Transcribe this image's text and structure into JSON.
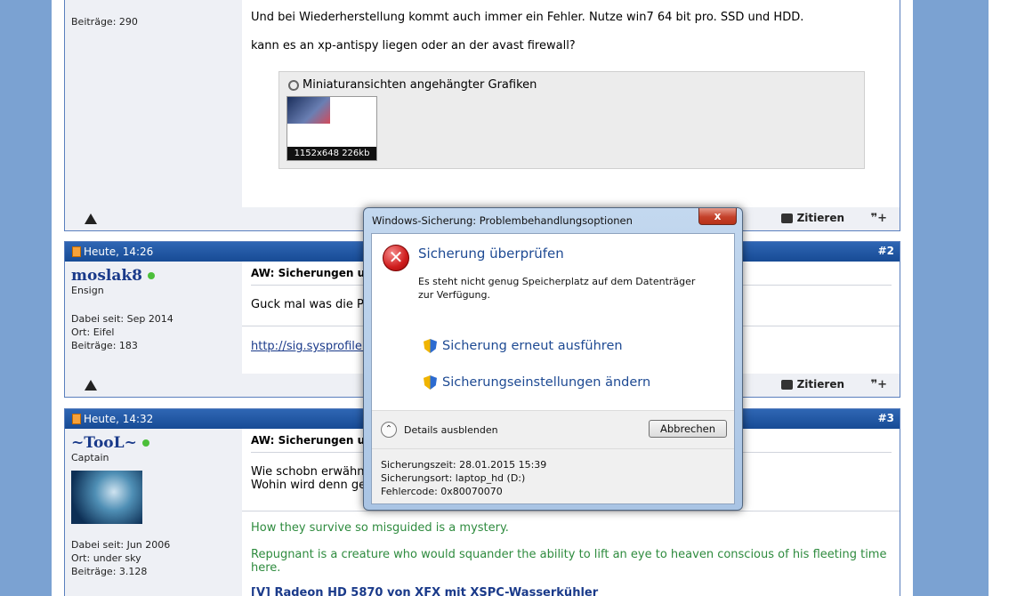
{
  "post1": {
    "posts_count": "Beiträge: 290",
    "line1": "Und bei Wiederherstellung kommt auch immer ein Fehler. Nutze win7 64 bit pro. SSD und HDD.",
    "line2": "kann es an xp-antispy liegen oder an der avast firewall?",
    "attachments_title": "Miniaturansichten angehängter Grafiken",
    "thumb_caption": "1152x648 226kb",
    "quote_label": "Zitieren",
    "mq_label": "❞+"
  },
  "post2": {
    "date": "Heute, 14:26",
    "number": "#2",
    "username": "moslak8",
    "rank": "Ensign",
    "joined": "Dabei seit: Sep 2014",
    "location": "Ort: Eifel",
    "posts_count": "Beiträge: 183",
    "title": "AW: Sicherungen un",
    "body": "Guck mal was die Pr",
    "sig_link": "http://sig.sysprofile.",
    "quote_label": "Zitieren",
    "mq_label": "❞+"
  },
  "post3": {
    "date": "Heute, 14:32",
    "number": "#3",
    "username": "~TooL~",
    "rank": "Captain",
    "joined": "Dabei seit: Jun 2006",
    "location": "Ort: under sky",
    "posts_count": "Beiträge: 3.128",
    "title": "AW: Sicherungen un",
    "body1": "Wie schobn erwähnt",
    "body2": "Wohin wird denn ge",
    "sig1": "How they survive so misguided is a mystery.",
    "sig2": "Repugnant is a creature who would squander the ability to lift an eye to heaven conscious of his fleeting time here.",
    "sig3": "[V] Radeon HD 5870 von XFX mit XSPC-Wasserkühler"
  },
  "dialog": {
    "title": "Windows-Sicherung: Problembehandlungsoptionen",
    "close": "x",
    "heading": "Sicherung überprüfen",
    "message": "Es steht nicht genug Speicherplatz auf dem Datenträger zur Verfügung.",
    "action1": "Sicherung erneut ausführen",
    "action2": "Sicherungseinstellungen ändern",
    "details_toggle": "Details ausblenden",
    "cancel": "Abbrechen",
    "detail_time": "Sicherungszeit: 28.01.2015 15:39",
    "detail_location": "Sicherungsort: laptop_hd (D:)",
    "detail_error": "Fehlercode: 0x80070070"
  },
  "colors": {
    "header_blue": "#174b95",
    "link_blue": "#1a3a8a",
    "sig_green": "#2e8b3e",
    "page_bg": "#7ba2d2"
  }
}
